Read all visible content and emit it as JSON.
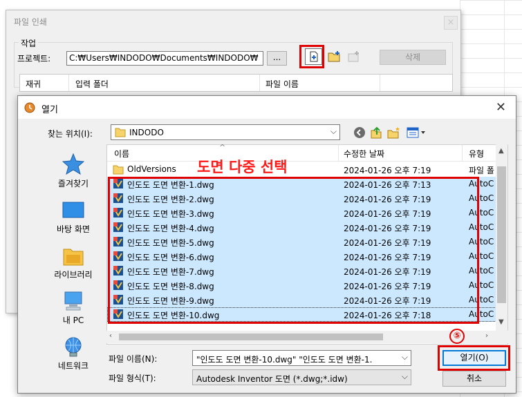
{
  "print_dialog": {
    "title": "파일 인쇄",
    "close": "×",
    "task_group": "작업",
    "project_label": "프로젝트:",
    "project_path": "C:₩Users₩INDODO₩Documents₩INDODO₩",
    "browse_label": "...",
    "delete_label": "삭제",
    "columns": [
      "재귀",
      "입력 폴더",
      "파일 이름"
    ]
  },
  "open_dialog": {
    "title": "열기",
    "close": "✕",
    "look_in_label": "찾는 위치(I):",
    "look_in_value": "INDODO",
    "places": [
      {
        "label": "즐겨찾기",
        "icon": "star-icon"
      },
      {
        "label": "바탕 화면",
        "icon": "desktop-icon"
      },
      {
        "label": "라이브러리",
        "icon": "library-icon"
      },
      {
        "label": "내 PC",
        "icon": "computer-icon"
      },
      {
        "label": "네트워크",
        "icon": "network-icon"
      }
    ],
    "columns": {
      "name": "이름",
      "date": "수정한 날짜",
      "type": "유형"
    },
    "folder_row": {
      "name": "OldVersions",
      "date": "2024-01-26 오후 7:19",
      "type": "파일 폴"
    },
    "files": [
      {
        "name": "인도도 도면 변환-1.dwg",
        "date": "2024-01-26 오후 7:13",
        "type": "AutoC"
      },
      {
        "name": "인도도 도면 변환-2.dwg",
        "date": "2024-01-26 오후 7:19",
        "type": "AutoC"
      },
      {
        "name": "인도도 도면 변환-3.dwg",
        "date": "2024-01-26 오후 7:19",
        "type": "AutoC"
      },
      {
        "name": "인도도 도면 변환-4.dwg",
        "date": "2024-01-26 오후 7:19",
        "type": "AutoC"
      },
      {
        "name": "인도도 도면 변환-5.dwg",
        "date": "2024-01-26 오후 7:19",
        "type": "AutoC"
      },
      {
        "name": "인도도 도면 변환-6.dwg",
        "date": "2024-01-26 오후 7:19",
        "type": "AutoC"
      },
      {
        "name": "인도도 도면 변환-7.dwg",
        "date": "2024-01-26 오후 7:19",
        "type": "AutoC"
      },
      {
        "name": "인도도 도면 변환-8.dwg",
        "date": "2024-01-26 오후 7:19",
        "type": "AutoC"
      },
      {
        "name": "인도도 도면 변환-9.dwg",
        "date": "2024-01-26 오후 7:19",
        "type": "AutoC"
      },
      {
        "name": "인도도 도면 변환-10.dwg",
        "date": "2024-01-26 오후 7:18",
        "type": "AutoC"
      }
    ],
    "file_name_label": "파일 이름(N):",
    "file_name_value": "\"인도도 도면 변환-10.dwg\" \"인도도 도면 변환-1.",
    "file_type_label": "파일 형식(T):",
    "file_type_value": "Autodesk Inventor 도면 (*.dwg;*.idw)",
    "open_button": "열기(O)",
    "cancel_button": "취소"
  },
  "annotation": {
    "multi_select_text": "도면 다중 선택",
    "step_number": "⑤",
    "highlight_color": "#e00000"
  }
}
